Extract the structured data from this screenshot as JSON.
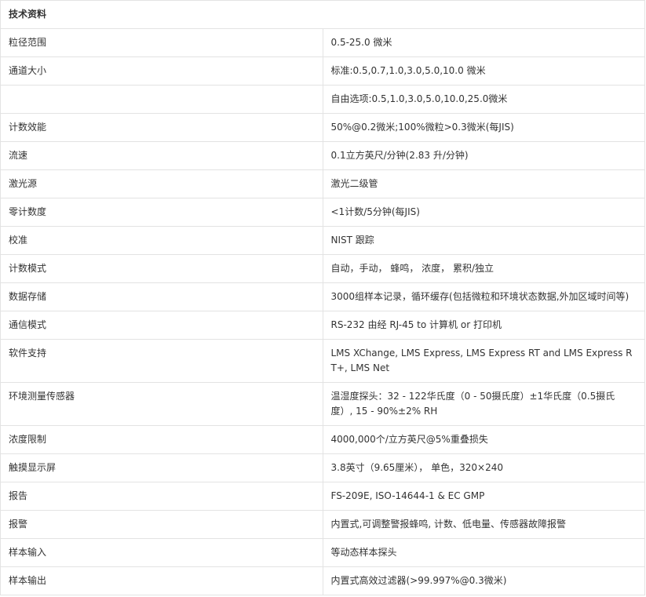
{
  "section_title": "技术资料",
  "rows": [
    {
      "label": "粒径范围",
      "value": "0.5-25.0 微米"
    },
    {
      "label": "通道大小",
      "value": "标准:0.5,0.7,1.0,3.0,5.0,10.0 微米"
    },
    {
      "label": "",
      "value": "自由选项:0.5,1.0,3.0,5.0,10.0,25.0微米"
    },
    {
      "label": "计数效能",
      "value": "50%@0.2微米;100%微粒>0.3微米(每JIS)"
    },
    {
      "label": "流速",
      "value": "0.1立方英尺/分钟(2.83 升/分钟)"
    },
    {
      "label": "激光源",
      "value": "激光二级管"
    },
    {
      "label": "零计数度",
      "value": "<1计数/5分钟(每JIS)"
    },
    {
      "label": "校准",
      "value": "NIST 跟踪"
    },
    {
      "label": "计数模式",
      "value": "自动，手动， 蜂鸣， 浓度， 累积/独立"
    },
    {
      "label": "数据存储",
      "value": "3000组样本记录，循环缓存(包括微粒和环境状态数据,外加区域时间等)"
    },
    {
      "label": "通信模式",
      "value": "RS-232 由经 RJ-45 to 计算机 or 打印机"
    },
    {
      "label": "软件支持",
      "value": "LMS XChange, LMS Express, LMS Express RT and LMS Express RT+, LMS Net"
    },
    {
      "label": "环境测量传感器",
      "value": "温湿度探头：32 - 122华氏度（0 - 50摄氏度）±1华氏度（0.5摄氏度）, 15 - 90%±2% RH"
    },
    {
      "label": "浓度限制",
      "value": "4000,000个/立方英尺@5%重叠损失"
    },
    {
      "label": "触摸显示屏",
      "value": "3.8英寸（9.65厘米）， 单色，320×240"
    },
    {
      "label": "报告",
      "value": "FS-209E, ISO-14644-1 & EC GMP"
    },
    {
      "label": "报警",
      "value": "内置式,可调整警报蜂鸣, 计数、低电量、传感器故障报警"
    },
    {
      "label": "样本输入",
      "value": "等动态样本探头"
    },
    {
      "label": "样本输出",
      "value": "内置式高效过滤器(>99.997%@0.3微米)"
    }
  ]
}
